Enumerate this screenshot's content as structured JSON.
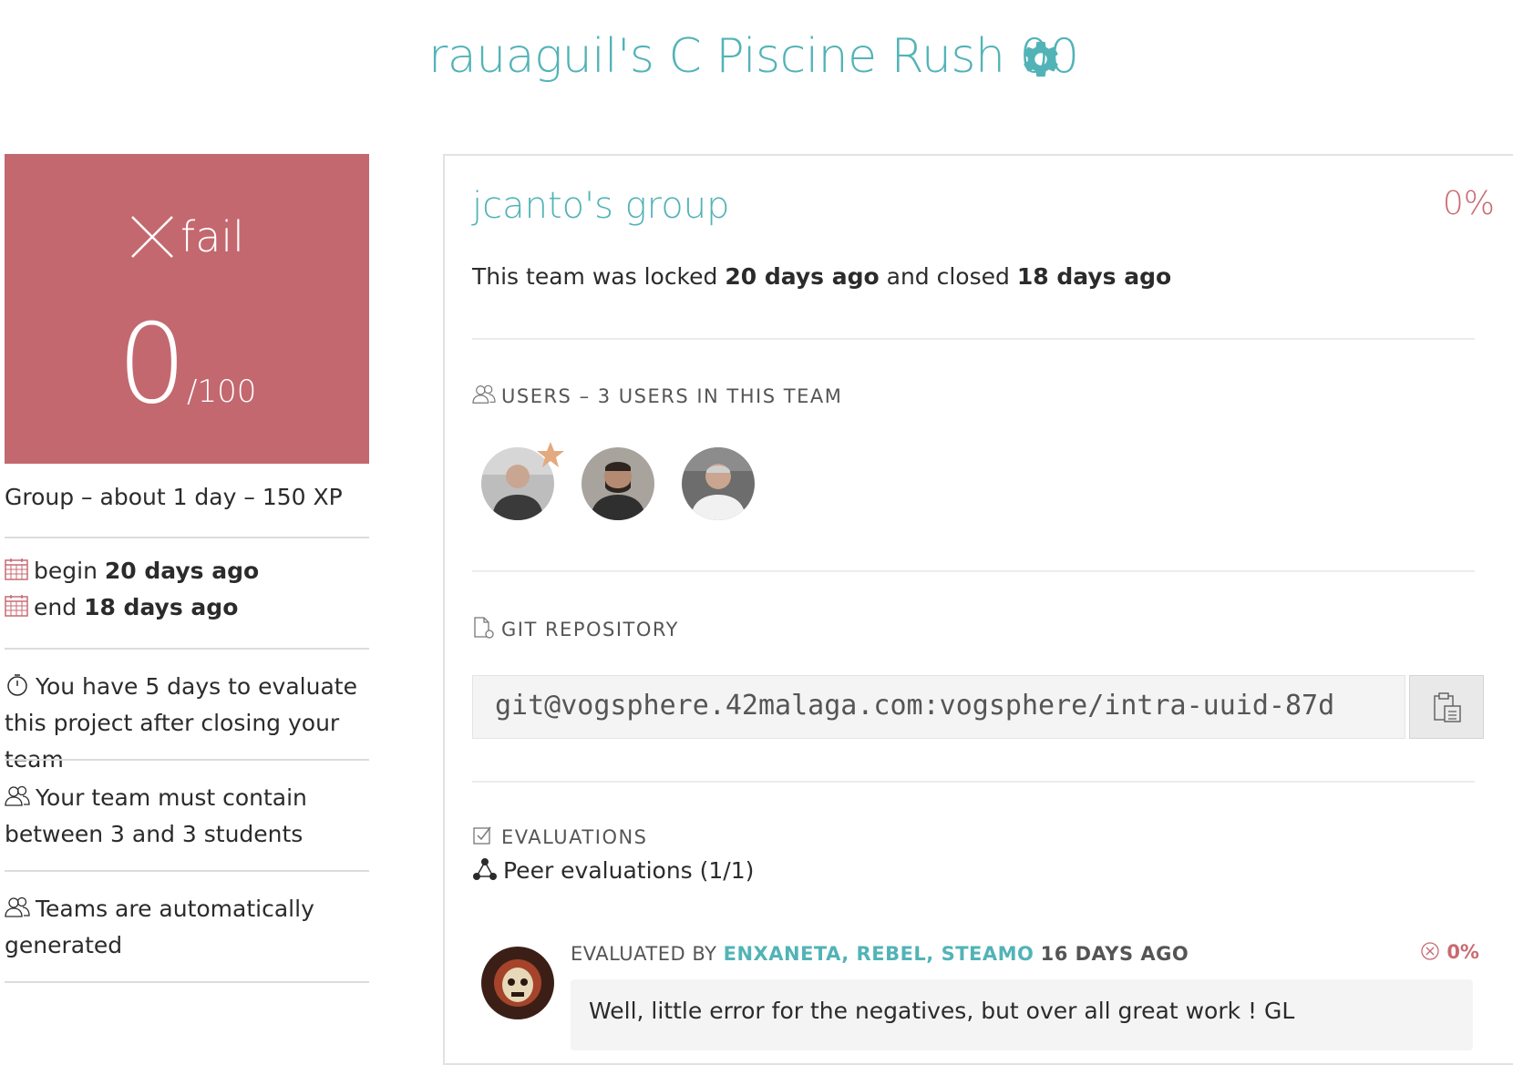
{
  "header": {
    "title": "rauaguil's C Piscine Rush 00",
    "settings_icon": "gear-icon"
  },
  "colors": {
    "accent": "#52b3b7",
    "fail": "#c3686f",
    "text": "#2b2b2b"
  },
  "grade": {
    "status_icon": "close-x-icon",
    "status": "fail",
    "score": "0",
    "max": "/100"
  },
  "project_info": {
    "summary": "Group – about 1 day – 150 XP",
    "begin_label": "begin",
    "begin_value": "20 days ago",
    "end_label": "end",
    "end_value": "18 days ago",
    "evaluate_note": "You have 5 days to evaluate this project after closing your team",
    "team_size_note": "Your team must contain between 3 and 3 students",
    "auto_team_note": "Teams are automatically generated"
  },
  "team": {
    "name": "jcanto's group",
    "percent": "0%",
    "locked_prefix": "This team was locked",
    "locked_value": "20 days ago",
    "closed_prefix": "and closed",
    "closed_value": "18 days ago",
    "users_heading": "USERS – 3 USERS IN THIS TEAM",
    "users": [
      {
        "leader": true
      },
      {
        "leader": false
      },
      {
        "leader": false
      }
    ],
    "git_heading": "GIT REPOSITORY",
    "git_url": "git@vogsphere.42malaga.com:vogsphere/intra-uuid-87d",
    "evaluations_heading": "EVALUATIONS",
    "peer_label": "Peer evaluations (1/1)",
    "evaluation": {
      "by_label": "EVALUATED BY",
      "evaluators": "ENXANETA, REBEL, STEAMO",
      "ago": "16 DAYS AGO",
      "score": "0%",
      "comment": "Well, little error for the negatives, but over all great work ! GL"
    }
  }
}
